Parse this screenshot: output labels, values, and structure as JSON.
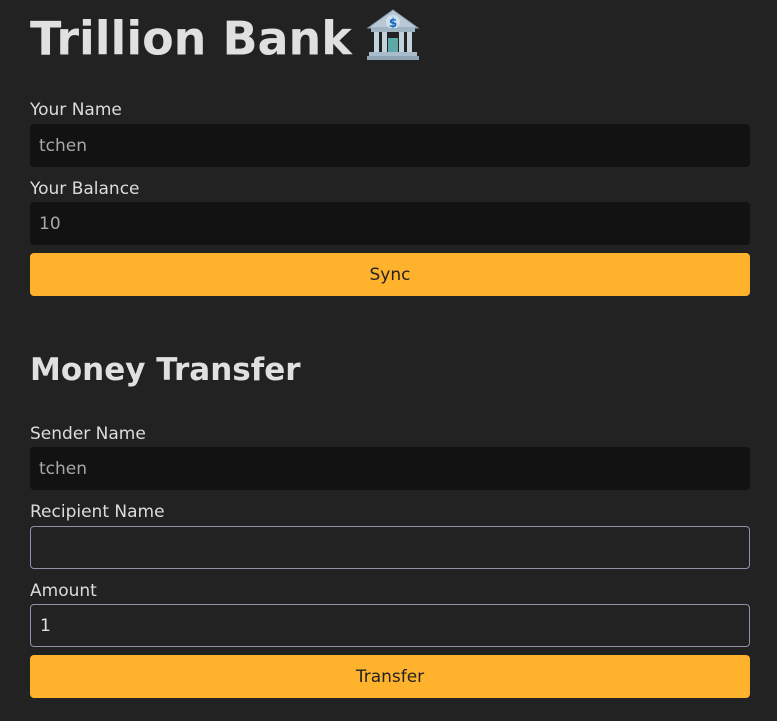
{
  "header": {
    "title": "Trillion Bank",
    "icon": "bank-icon"
  },
  "account": {
    "name_label": "Your Name",
    "name_value": "tchen",
    "balance_label": "Your Balance",
    "balance_value": "10",
    "sync_label": "Sync"
  },
  "transfer": {
    "title": "Money Transfer",
    "sender_label": "Sender Name",
    "sender_value": "tchen",
    "recipient_label": "Recipient Name",
    "recipient_value": "",
    "amount_label": "Amount",
    "amount_value": "1",
    "transfer_label": "Transfer"
  },
  "colors": {
    "accent": "#ffb22c",
    "background": "#222222",
    "readonly_field": "#121212",
    "field_border": "#8e93ab"
  }
}
